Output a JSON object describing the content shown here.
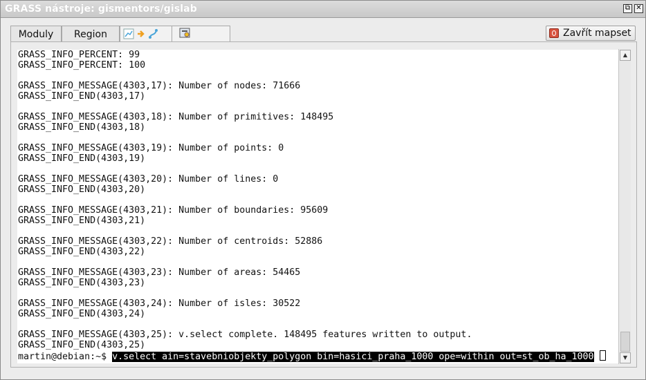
{
  "window": {
    "title": "GRASS nástroje: gismentors/gislab",
    "restore_glyph": "⧉",
    "close_glyph": "✕"
  },
  "tabs": [
    {
      "label": "Moduly"
    },
    {
      "label": "Region"
    }
  ],
  "toolbar": {
    "close_mapset_label": "Zavřít mapset",
    "close_mapset_icon": "power-icon"
  },
  "terminal": {
    "lines": [
      "GRASS_INFO_PERCENT: 99",
      "GRASS_INFO_PERCENT: 100",
      "",
      "GRASS_INFO_MESSAGE(4303,17): Number of nodes: 71666",
      "GRASS_INFO_END(4303,17)",
      "",
      "GRASS_INFO_MESSAGE(4303,18): Number of primitives: 148495",
      "GRASS_INFO_END(4303,18)",
      "",
      "GRASS_INFO_MESSAGE(4303,19): Number of points: 0",
      "GRASS_INFO_END(4303,19)",
      "",
      "GRASS_INFO_MESSAGE(4303,20): Number of lines: 0",
      "GRASS_INFO_END(4303,20)",
      "",
      "GRASS_INFO_MESSAGE(4303,21): Number of boundaries: 95609",
      "GRASS_INFO_END(4303,21)",
      "",
      "GRASS_INFO_MESSAGE(4303,22): Number of centroids: 52886",
      "GRASS_INFO_END(4303,22)",
      "",
      "GRASS_INFO_MESSAGE(4303,23): Number of areas: 54465",
      "GRASS_INFO_END(4303,23)",
      "",
      "GRASS_INFO_MESSAGE(4303,24): Number of isles: 30522",
      "GRASS_INFO_END(4303,24)",
      "",
      "GRASS_INFO_MESSAGE(4303,25): v.select complete. 148495 features written to output.",
      "GRASS_INFO_END(4303,25)"
    ],
    "prompt": "martin@debian:~$ ",
    "command": "v.select ain=stavebniobjekty_polygon bin=hasici_praha_1000 ope=within out=st_ob_ha_1000"
  },
  "scrollbar": {
    "up_glyph": "▲",
    "down_glyph": "▼"
  }
}
